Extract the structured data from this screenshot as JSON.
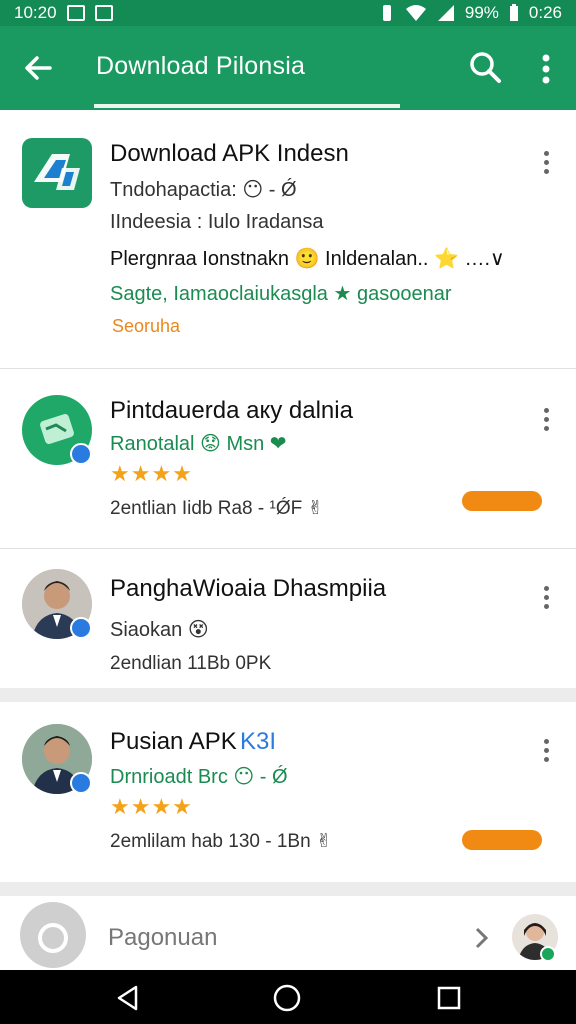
{
  "status_bar": {
    "time": "10:20",
    "battery": "99%",
    "clock_right": "0:26"
  },
  "app_bar": {
    "title": "Download Pilonsia",
    "back_icon": "arrow-left-icon",
    "search_icon": "search-icon",
    "more_icon": "more-vert-icon"
  },
  "featured": {
    "title": "Download APK Indesn",
    "line1": "Tndohapactia: 😶 - Ǿ",
    "line2": "IIndeesia : Iulo Iradansa",
    "line3": "Plergnraa Ionstnakn 🙂 Inldenalan.. ⭐ ….∨",
    "line4": "Sagte, Iamaoclaiukasgla ★ gasooenar",
    "tag": "Seoruha"
  },
  "items": [
    {
      "title": "Pintdauerda аку dalnia",
      "subtitle": "Ranotalal 😟 Msn ❤",
      "rating": "★★★★",
      "meta": "2entlian Iidb Ra8 - ¹ǾF ✌"
    },
    {
      "title": "PanghaWioaia Dhasmpiia",
      "subtitle": "Siaokan 😵",
      "meta": "2endlian  11Bb 0PK"
    },
    {
      "title": "Pusian APK",
      "title_badge": "K3I",
      "subtitle": "Drnrioadt Brc 😶 - Ǿ",
      "rating": "★★★★",
      "meta": "2emlilam hab 130 - 1Bn ✌"
    }
  ],
  "bottom": {
    "label": "Pagonuan",
    "camera_icon": "camera-icon",
    "chevron_icon": "chevron-right-icon"
  },
  "colors": {
    "primary": "#1a9a60",
    "status": "#148a55",
    "accent_orange": "#f08a12",
    "star": "#f3a31a",
    "verified": "#2a7be0"
  }
}
